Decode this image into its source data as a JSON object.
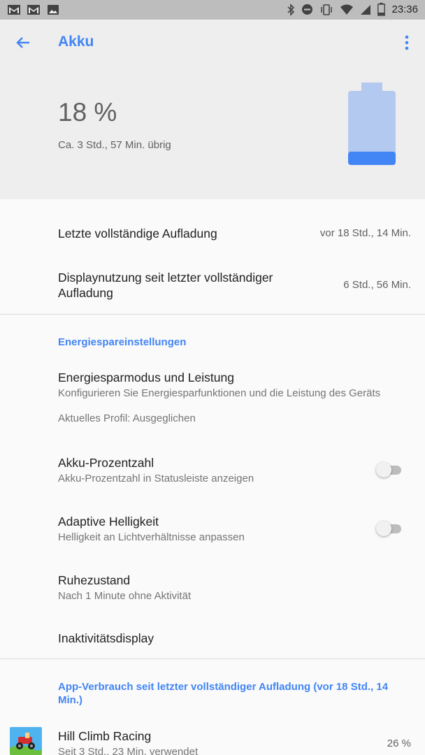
{
  "status_bar": {
    "time": "23:36",
    "left_icons": [
      "gmail-icon",
      "gmail-icon",
      "image-icon"
    ],
    "right_icons": [
      "bluetooth-icon",
      "dnd-icon",
      "vibrate-icon",
      "wifi-icon",
      "signal-icon",
      "battery-icon"
    ]
  },
  "header": {
    "title": "Akku",
    "battery_percent": "18 %",
    "battery_level": 0.18,
    "remaining": "Ca. 3 Std., 57 Min. übrig"
  },
  "colors": {
    "accent": "#4285f4",
    "battery_empty": "#b4c9ef",
    "battery_fill": "#4285f4"
  },
  "usage": {
    "last_charge_label": "Letzte vollständige Aufladung",
    "last_charge_value": "vor 18 Std., 14 Min.",
    "display_usage_label": "Displaynutzung seit letzter vollständiger Aufladung",
    "display_usage_value": "6 Std., 56 Min."
  },
  "energy_section": {
    "title": "Energiespareinstellungen",
    "items": [
      {
        "title": "Energiesparmodus und Leistung",
        "subtitle": "Konfigurieren Sie Energiesparfunktionen und die Leistung des Geräts",
        "extra": "Aktuelles Profil: Ausgeglichen"
      },
      {
        "title": "Akku-Prozentzahl",
        "subtitle": "Akku-Prozentzahl in Statusleiste anzeigen",
        "toggle_on": false
      },
      {
        "title": "Adaptive Helligkeit",
        "subtitle": "Helligkeit an Lichtverhältnisse anpassen",
        "toggle_on": false
      },
      {
        "title": "Ruhezustand",
        "subtitle": "Nach 1 Minute ohne Aktivität"
      },
      {
        "title": "Inaktivitätsdisplay"
      }
    ]
  },
  "app_usage": {
    "title": "App-Verbrauch seit letzter vollständiger Aufladung (vor 18 Std., 14 Min.)",
    "apps": [
      {
        "name": "Hill Climb Racing",
        "detail": "Seit 3 Std., 23 Min. verwendet",
        "percent": "26 %"
      }
    ]
  }
}
